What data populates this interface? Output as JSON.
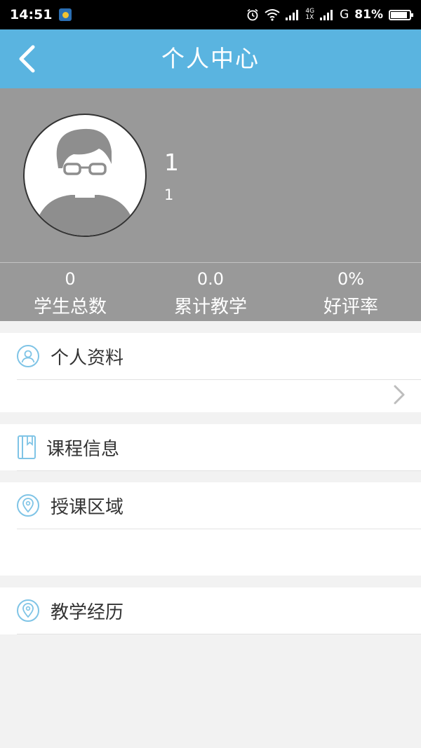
{
  "status_bar": {
    "time": "14:51",
    "network_top": "4G",
    "network_bottom": "1X",
    "network_type": "G",
    "battery": "81%",
    "battery_level": 0.81
  },
  "header": {
    "title": "个人中心",
    "back_icon": "chevron-left-icon",
    "bg_color": "#5ab4e0"
  },
  "profile": {
    "name": "1",
    "subtitle": "1",
    "avatar_icon": "default-avatar-glasses"
  },
  "stats": [
    {
      "value": "0",
      "label": "学生总数"
    },
    {
      "value": "0.0",
      "label": "累计教学"
    },
    {
      "value": "0%",
      "label": "好评率"
    }
  ],
  "menu": {
    "personal_info": {
      "label": "个人资料",
      "icon": "user-icon"
    },
    "course_info": {
      "label": "课程信息",
      "icon": "book-icon"
    },
    "teaching_area": {
      "label": "授课区域",
      "icon": "location-pin-icon"
    },
    "teaching_history": {
      "label": "教学经历",
      "icon": "location-pin-icon"
    }
  }
}
